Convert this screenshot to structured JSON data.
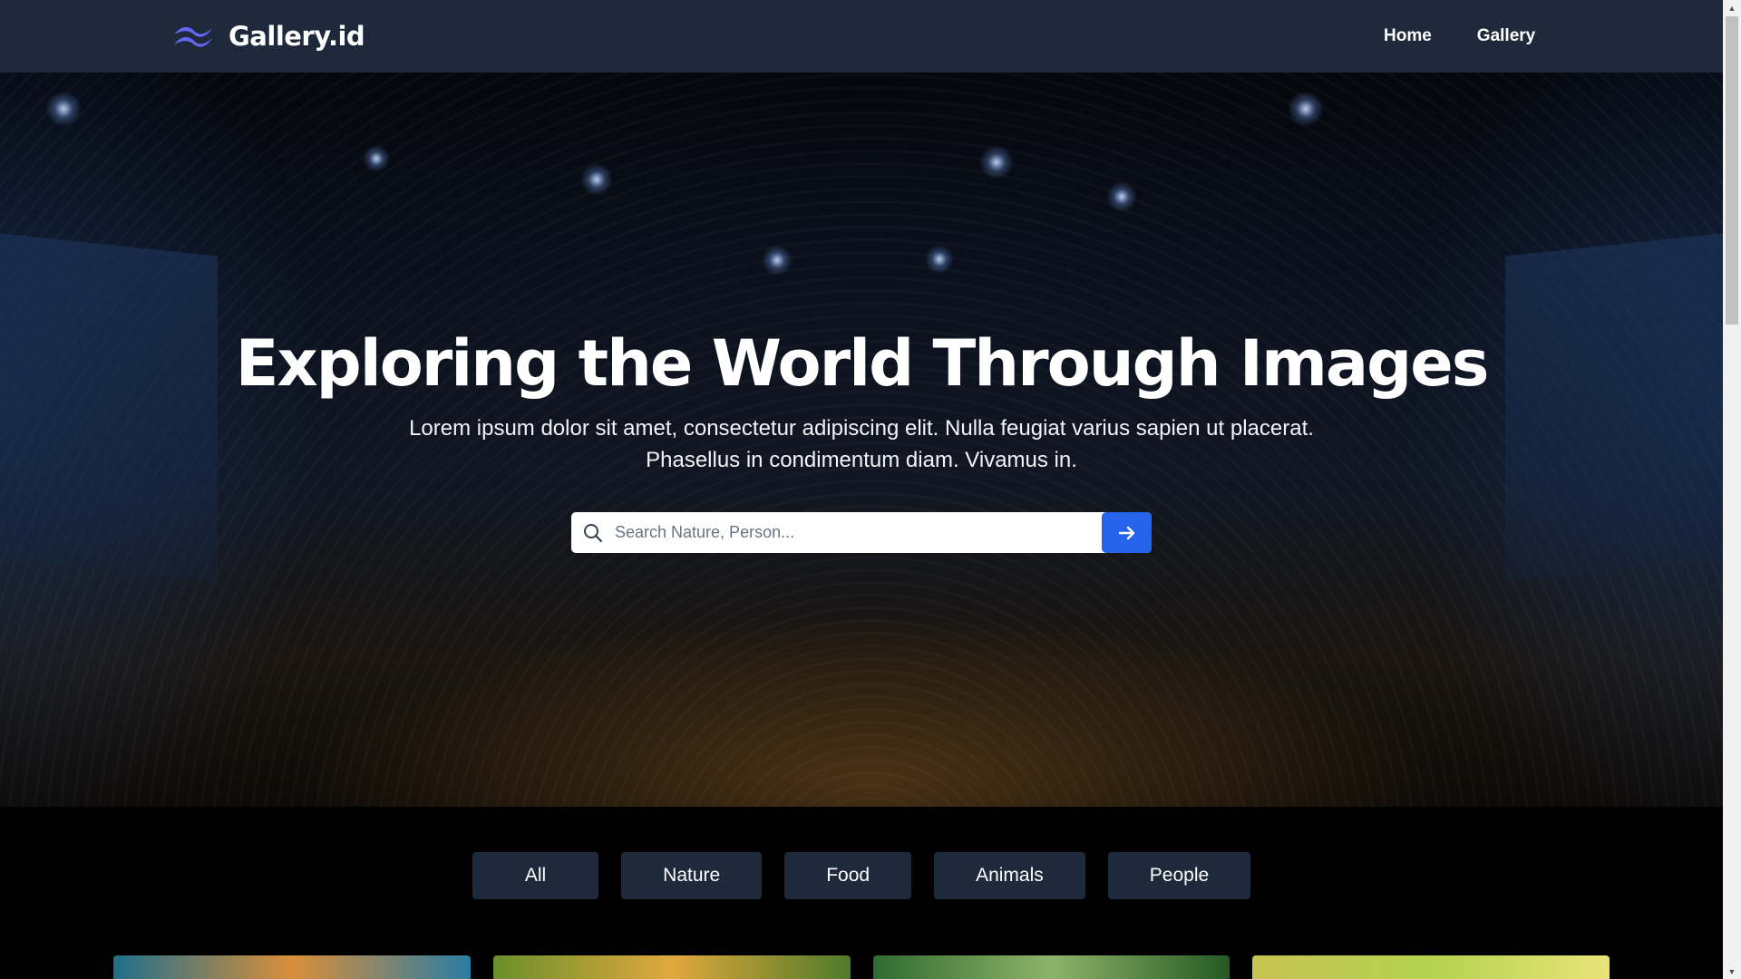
{
  "nav": {
    "brand": "Gallery.id",
    "logo_icon": "wave-logo-icon",
    "links": [
      "Home",
      "Gallery"
    ]
  },
  "hero": {
    "title": "Exploring the World Through Images",
    "subtitle_line1": "Lorem ipsum dolor sit amet, consectetur adipiscing elit. Nulla feugiat varius sapien ut placerat.",
    "subtitle_line2": "Phasellus in condimentum diam. Vivamus in.",
    "background_image": "conference-audience-photo"
  },
  "search": {
    "placeholder": "Search Nature, Person...",
    "value": "",
    "icon": "search-icon",
    "submit_icon": "arrow-right-icon"
  },
  "filters": [
    "All",
    "Nature",
    "Food",
    "Animals",
    "People"
  ],
  "gallery": {
    "thumbnails": [
      "landscape-photo",
      "forest-photo",
      "jungle-photo",
      "meadow-photo"
    ]
  },
  "colors": {
    "navbar": "#1e293b",
    "accent": "#2563eb",
    "filter_button": "#1e293b",
    "page_background": "#000000"
  }
}
